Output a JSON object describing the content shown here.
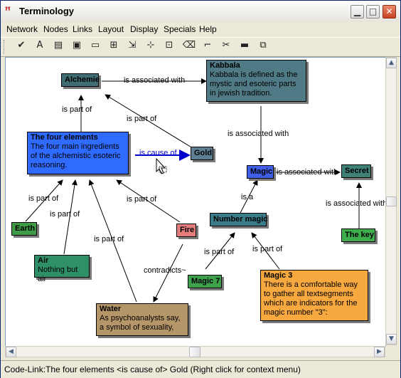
{
  "window": {
    "title": "Terminology"
  },
  "menu": [
    "Network",
    "Nodes",
    "Links",
    "Layout",
    "Display",
    "Specials",
    "Help"
  ],
  "toolbar": {
    "tools": [
      {
        "name": "check-icon",
        "glyph": "✔"
      },
      {
        "name": "text-icon",
        "glyph": "A"
      },
      {
        "name": "color-bars-icon",
        "glyph": "▤"
      },
      {
        "name": "image-icon",
        "glyph": "▣"
      },
      {
        "name": "window-icon",
        "glyph": "▭"
      },
      {
        "name": "tree-layout-icon",
        "glyph": "⊞"
      },
      {
        "name": "import-icon",
        "glyph": "⇲"
      },
      {
        "name": "grid-select-icon",
        "glyph": "⊹"
      },
      {
        "name": "frame-select-icon",
        "glyph": "⊡"
      },
      {
        "name": "eraser-icon",
        "glyph": "⌫"
      },
      {
        "name": "link-tool-icon",
        "glyph": "⌐"
      },
      {
        "name": "scissors-icon",
        "glyph": "✂"
      },
      {
        "name": "note-icon",
        "glyph": "▬"
      },
      {
        "name": "copy-node-icon",
        "glyph": "⧉"
      }
    ]
  },
  "nodes": {
    "alchemie": {
      "title": "Alchemie",
      "bg": "#3f6d72",
      "fg": "#000000"
    },
    "kabbala": {
      "title": "Kabbala",
      "body": "Kabbala is defined as the mystic and esoteric parts in jewish tradition.",
      "bg": "#4f7a86",
      "fg": "#000000"
    },
    "four_elements": {
      "title": "The four elements",
      "body": "The four main ingredients of the alchemistic esoteric reasoning.",
      "bg": "#2f6bff",
      "fg": "#000000"
    },
    "gold": {
      "title": "Gold",
      "bg": "#5e7f92",
      "fg": "#000000"
    },
    "magic": {
      "title": "Magic",
      "bg": "#3f5fe8",
      "fg": "#000000"
    },
    "secret": {
      "title": "Secret",
      "bg": "#3f8174",
      "fg": "#000000"
    },
    "number_magic": {
      "title": "Number magic",
      "bg": "#3a7c8a",
      "fg": "#000000"
    },
    "the_key": {
      "title": "The key",
      "bg": "#3fae4c",
      "fg": "#000000"
    },
    "earth": {
      "title": "Earth",
      "bg": "#3f9b45",
      "fg": "#000000"
    },
    "fire": {
      "title": "Fire",
      "bg": "#e47c7c",
      "fg": "#000000"
    },
    "air": {
      "title": "Air",
      "body": "Nothing but air",
      "bg": "#2f8f67",
      "fg": "#000000"
    },
    "magic7": {
      "title": "Magic 7",
      "bg": "#3da04a",
      "fg": "#000000"
    },
    "magic3": {
      "title": "Magic 3",
      "body": "There is a comfortable way to gather all textsegments which are indicators for the magic number \"3\":",
      "bg": "#f7a83e",
      "fg": "#000000"
    },
    "water": {
      "title": "Water",
      "body": "As psychoanalysts say, a symbol of sexuality,",
      "bg": "#b59668",
      "fg": "#000000"
    }
  },
  "links": {
    "alchemie_kabbala": "is associated with",
    "four_alchemie": "is part of",
    "gold_alchemie": "is part of",
    "four_gold": "is cause of",
    "kabbala_magic": "is associated with",
    "magic_secret": "is associated with",
    "number_magic": "is a",
    "key_secret": "is associated with",
    "earth_four": "is part of",
    "air_four": "is part of",
    "fire_four": "is part of",
    "water_four": "is part of",
    "fire_water": "contradicts~",
    "magic7_number": "is part of",
    "magic3_number": "is part of"
  },
  "status": "Code-Link:The four elements <is cause of> Gold (Right click for context menu)"
}
